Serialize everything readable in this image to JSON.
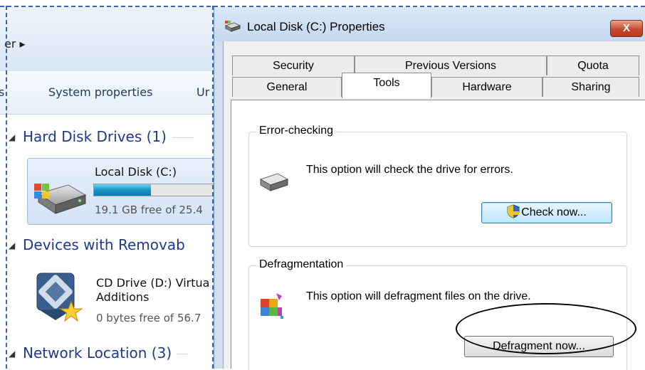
{
  "explorer": {
    "address_fragment": "er ▸",
    "commands": [
      "s",
      "System properties",
      "Ur"
    ],
    "sections": {
      "hard_disk": "Hard Disk Drives (1)",
      "removable": "Devices with Removab",
      "network": "Network Location (3)"
    },
    "local_disk": {
      "name": "Local Disk (C:)",
      "free_text": "19.1 GB free of 25.4",
      "used_fraction": 0.25
    },
    "cd_drive": {
      "name_line1": "CD Drive (D:) Virtua",
      "name_line2": "Additions",
      "free_text": "0 bytes free of 56.7"
    }
  },
  "dialog": {
    "title": "Local Disk (C:) Properties",
    "close_label": "X",
    "tabs_row1": [
      "Security",
      "Previous Versions",
      "Quota"
    ],
    "tabs_row2": [
      "General",
      "Tools",
      "Hardware",
      "Sharing"
    ],
    "active_tab": "Tools",
    "error_checking": {
      "label": "Error-checking",
      "description": "This option will check the drive for errors.",
      "button": "Check now..."
    },
    "defragmentation": {
      "label": "Defragmentation",
      "description": "This option will defragment files on the drive.",
      "button": "Defragment now..."
    }
  },
  "colors": {
    "accent_blue": "#1e3a8a",
    "progress_fill": "#1896c8",
    "close_red": "#c74b2f",
    "annotation": "#000000"
  },
  "icons": [
    "hard-drive-icon",
    "cd-drive-icon",
    "disk-icon",
    "defrag-icon",
    "uac-shield-icon",
    "title-drive-icon",
    "collapse-triangle-icon"
  ]
}
